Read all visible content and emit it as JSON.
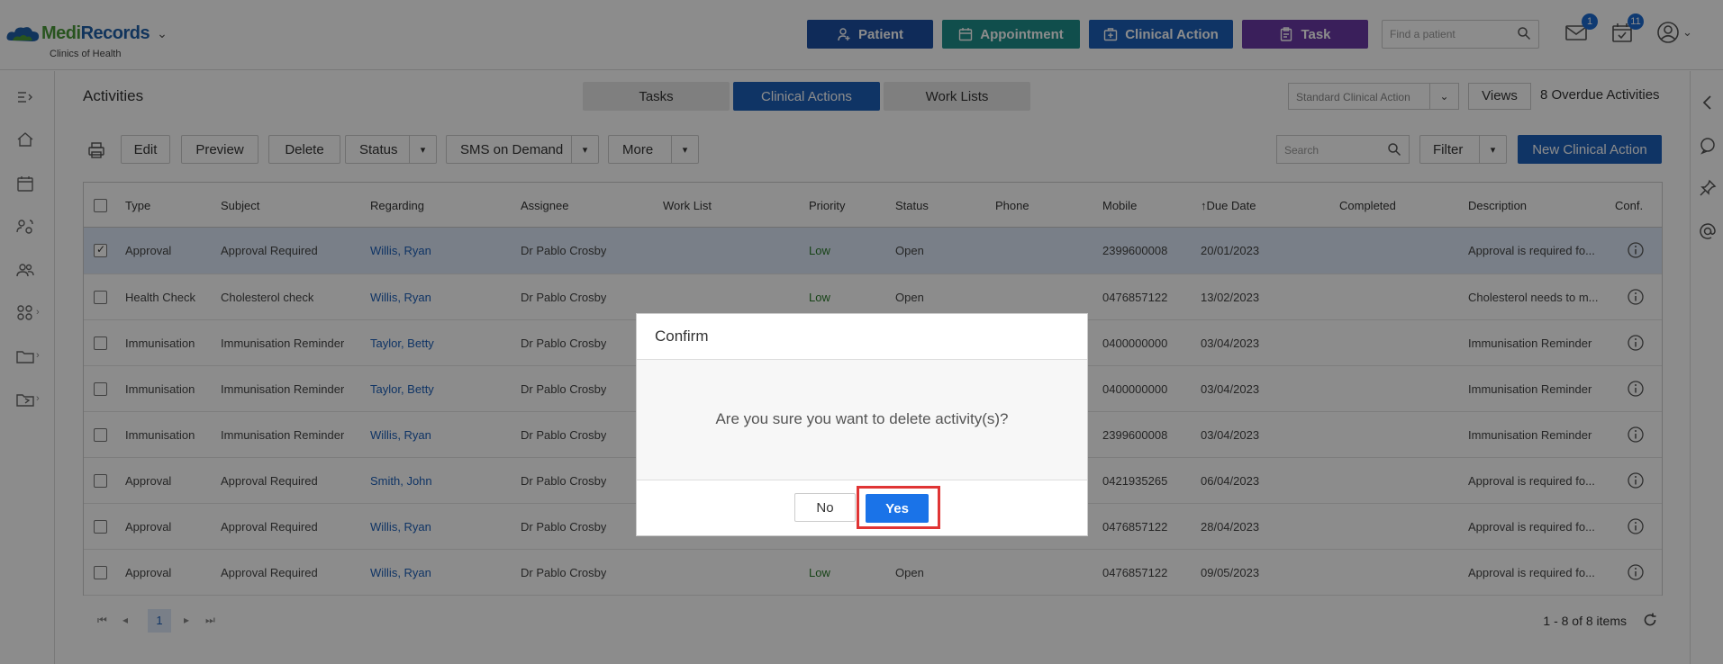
{
  "brand": {
    "name_part1": "Medi",
    "name_part2": "Records",
    "subtitle": "Clinics of Health"
  },
  "header": {
    "buttons": [
      {
        "label": "Patient",
        "icon": "person-plus-icon",
        "color": "#1d4fa3"
      },
      {
        "label": "Appointment",
        "icon": "calendar-icon",
        "color": "#1e8f8a"
      },
      {
        "label": "Clinical Action",
        "icon": "medical-kit-icon",
        "color": "#1d5fb8"
      },
      {
        "label": "Task",
        "icon": "clipboard-icon",
        "color": "#6a3aa6"
      }
    ],
    "find_patient_placeholder": "Find a patient",
    "mail_badge": "1",
    "tasks_badge": "11"
  },
  "page": {
    "title": "Activities",
    "tabs": [
      "Tasks",
      "Clinical Actions",
      "Work Lists"
    ],
    "active_tab": "Clinical Actions",
    "view_select": "Standard Clinical Action",
    "views_label": "Views",
    "overdue": "8 Overdue Activities"
  },
  "toolbar": {
    "edit": "Edit",
    "preview": "Preview",
    "delete": "Delete",
    "status": "Status",
    "sms": "SMS on Demand",
    "more": "More",
    "search_placeholder": "Search",
    "filter": "Filter",
    "new": "New Clinical Action"
  },
  "grid": {
    "columns": [
      "Type",
      "Subject",
      "Regarding",
      "Assignee",
      "Work List",
      "Priority",
      "Status",
      "Phone",
      "Mobile",
      "Due Date",
      "Completed",
      "Description",
      "Conf."
    ],
    "rows": [
      {
        "type": "Approval",
        "subject": "Approval Required",
        "regarding": "Willis, Ryan",
        "assignee": "Dr Pablo Crosby",
        "priority": "Low",
        "status": "Open",
        "mobile": "2399600008",
        "due": "20/01/2023",
        "description": "Approval is required fo...",
        "checked": true
      },
      {
        "type": "Health Check",
        "subject": "Cholesterol check",
        "regarding": "Willis, Ryan",
        "assignee": "Dr Pablo Crosby",
        "priority": "Low",
        "status": "Open",
        "mobile": "0476857122",
        "due": "13/02/2023",
        "description": "Cholesterol needs to m...",
        "checked": false
      },
      {
        "type": "Immunisation",
        "subject": "Immunisation Reminder",
        "regarding": "Taylor, Betty",
        "assignee": "Dr Pablo Crosby",
        "priority": "",
        "status": "",
        "mobile": "0400000000",
        "due": "03/04/2023",
        "description": "Immunisation Reminder",
        "checked": false
      },
      {
        "type": "Immunisation",
        "subject": "Immunisation Reminder",
        "regarding": "Taylor, Betty",
        "assignee": "Dr Pablo Crosby",
        "priority": "",
        "status": "",
        "mobile": "0400000000",
        "due": "03/04/2023",
        "description": "Immunisation Reminder",
        "checked": false
      },
      {
        "type": "Immunisation",
        "subject": "Immunisation Reminder",
        "regarding": "Willis, Ryan",
        "assignee": "Dr Pablo Crosby",
        "priority": "",
        "status": "",
        "mobile": "2399600008",
        "due": "03/04/2023",
        "description": "Immunisation Reminder",
        "checked": false
      },
      {
        "type": "Approval",
        "subject": "Approval Required",
        "regarding": "Smith, John",
        "assignee": "Dr Pablo Crosby",
        "priority": "",
        "status": "",
        "mobile": "0421935265",
        "due": "06/04/2023",
        "description": "Approval is required fo...",
        "checked": false
      },
      {
        "type": "Approval",
        "subject": "Approval Required",
        "regarding": "Willis, Ryan",
        "assignee": "Dr Pablo Crosby",
        "priority": "",
        "status": "",
        "mobile": "0476857122",
        "due": "28/04/2023",
        "description": "Approval is required fo...",
        "checked": false
      },
      {
        "type": "Approval",
        "subject": "Approval Required",
        "regarding": "Willis, Ryan",
        "assignee": "Dr Pablo Crosby",
        "priority": "Low",
        "status": "Open",
        "mobile": "0476857122",
        "due": "09/05/2023",
        "description": "Approval is required fo...",
        "checked": false
      }
    ]
  },
  "pager": {
    "current_page": "1",
    "summary": "1 - 8 of 8 items"
  },
  "modal": {
    "title": "Confirm",
    "message": "Are you sure you want to delete activity(s)?",
    "no_label": "No",
    "yes_label": "Yes"
  }
}
